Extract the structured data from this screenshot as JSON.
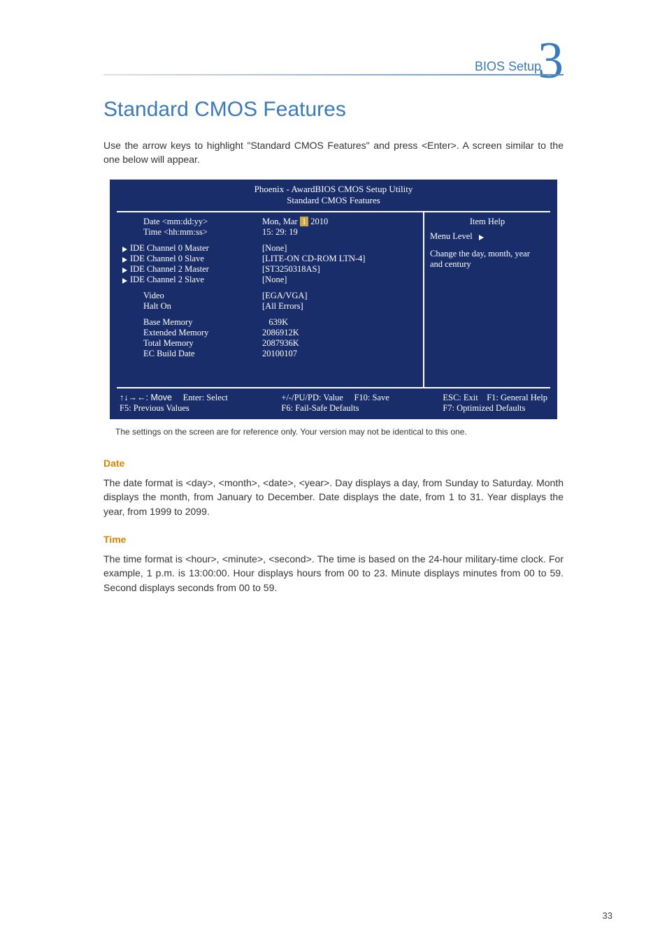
{
  "header": {
    "label": "BIOS Setup",
    "chapter": "3"
  },
  "title": "Standard CMOS Features",
  "intro": "Use the arrow keys to highlight \"Standard CMOS Features\" and press <Enter>. A screen similar to the one below will appear.",
  "bios": {
    "title_line1": "Phoenix - AwardBIOS CMOS Setup Utility",
    "title_line2": "Standard CMOS Features",
    "rows": {
      "date_label": "Date <mm:dd:yy>",
      "date_value_prefix": "Mon, Mar ",
      "date_value_highlight": "1",
      "date_value_suffix": " 2010",
      "time_label": "Time <hh:mm:ss>",
      "time_value": "15: 29: 19",
      "ide0m_label": "IDE Channel 0 Master",
      "ide0m_value": "[None]",
      "ide0s_label": "IDE Channel 0 Slave",
      "ide0s_value": "[LITE-ON CD-ROM LTN-4]",
      "ide2m_label": "IDE Channel 2 Master",
      "ide2m_value": "[ST3250318AS]",
      "ide2s_label": "IDE Channel 2 Slave",
      "ide2s_value": "[None]",
      "video_label": "Video",
      "video_value": "[EGA/VGA]",
      "halt_label": "Halt On",
      "halt_value": "[All Errors]",
      "base_label": "Base Memory",
      "base_value": "   639K",
      "ext_label": "Extended Memory",
      "ext_value": "2086912K",
      "total_label": "Total Memory",
      "total_value": "2087936K",
      "ec_label": "EC Build Date",
      "ec_value": "20100107"
    },
    "help": {
      "title": "Item Help",
      "menu_level": "Menu Level",
      "desc": "Change the day, month, year and century"
    },
    "footer": {
      "move": "↑↓→←: Move",
      "enter": "Enter: Select",
      "pupd": "+/-/PU/PD: Value",
      "f10": "F10: Save",
      "esc": "ESC: Exit",
      "f1": "F1: General Help",
      "f5": "F5: Previous Values",
      "f6": "F6: Fail-Safe Defaults",
      "f7": "F7: Optimized Defaults"
    }
  },
  "caption": "The settings on the screen are for reference only. Your version may not be identical to this one.",
  "sections": {
    "date": {
      "title": "Date",
      "body": "The date format is <day>, <month>, <date>, <year>. Day displays a day, from Sunday to Saturday. Month displays the month, from January to December. Date displays the date, from 1 to 31. Year displays the year, from 1999 to 2099."
    },
    "time": {
      "title": "Time",
      "body": "The time format is <hour>, <minute>, <second>. The time is based on the 24-hour military-time clock. For example, 1 p.m. is 13:00:00. Hour displays hours from 00 to 23. Minute displays minutes from 00 to 59. Second displays seconds from 00 to 59."
    }
  },
  "page_number": "33"
}
